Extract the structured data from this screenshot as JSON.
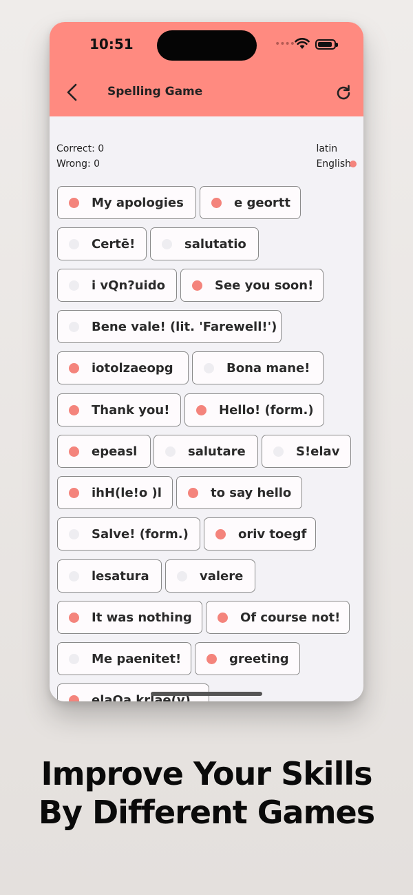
{
  "status": {
    "time": "10:51",
    "dots": "••••"
  },
  "header": {
    "title": "Spelling Game",
    "back": "back-arrow-icon",
    "refresh": "refresh-icon"
  },
  "score": {
    "correct": "Correct: 0",
    "wrong": "Wrong: 0"
  },
  "languages": {
    "source": "latin",
    "target": "English",
    "target_selected": true
  },
  "colors": {
    "topbar": "#ff8a80",
    "dot_on": "#f4847c",
    "dot_off": "#eeedf1"
  },
  "chips": [
    {
      "label": "My apologies",
      "marked": true
    },
    {
      "label": "e geortt",
      "marked": true
    },
    {
      "label": "Certē!",
      "marked": false
    },
    {
      "label": "salutatio",
      "marked": false
    },
    {
      "label": "i vQn?uido",
      "marked": false
    },
    {
      "label": "See you soon!",
      "marked": true
    },
    {
      "label": "Bene vale! (lit. 'Farewell!')",
      "marked": false
    },
    {
      "label": "iotolzaeopg",
      "marked": true
    },
    {
      "label": "Bona mane!",
      "marked": false
    },
    {
      "label": "Thank you!",
      "marked": true
    },
    {
      "label": "Hello! (form.)",
      "marked": true
    },
    {
      "label": "epeasl",
      "marked": true
    },
    {
      "label": "salutare",
      "marked": false
    },
    {
      "label": "S!elav",
      "marked": false
    },
    {
      "label": "ihH(le!o )l",
      "marked": true
    },
    {
      "label": "to say hello",
      "marked": true
    },
    {
      "label": "Salve! (form.)",
      "marked": false
    },
    {
      "label": "oriv toegf",
      "marked": true
    },
    {
      "label": "lesatura",
      "marked": false
    },
    {
      "label": "valere",
      "marked": false
    },
    {
      "label": "It was nothing",
      "marked": true
    },
    {
      "label": "Of course not!",
      "marked": true
    },
    {
      "label": "Me paenitet!",
      "marked": false
    },
    {
      "label": "greeting",
      "marked": true
    },
    {
      "label": "elaQa krlae(v)",
      "marked": true
    }
  ],
  "caption": {
    "line1": "Improve Your Skills",
    "line2": "By Different Games"
  }
}
